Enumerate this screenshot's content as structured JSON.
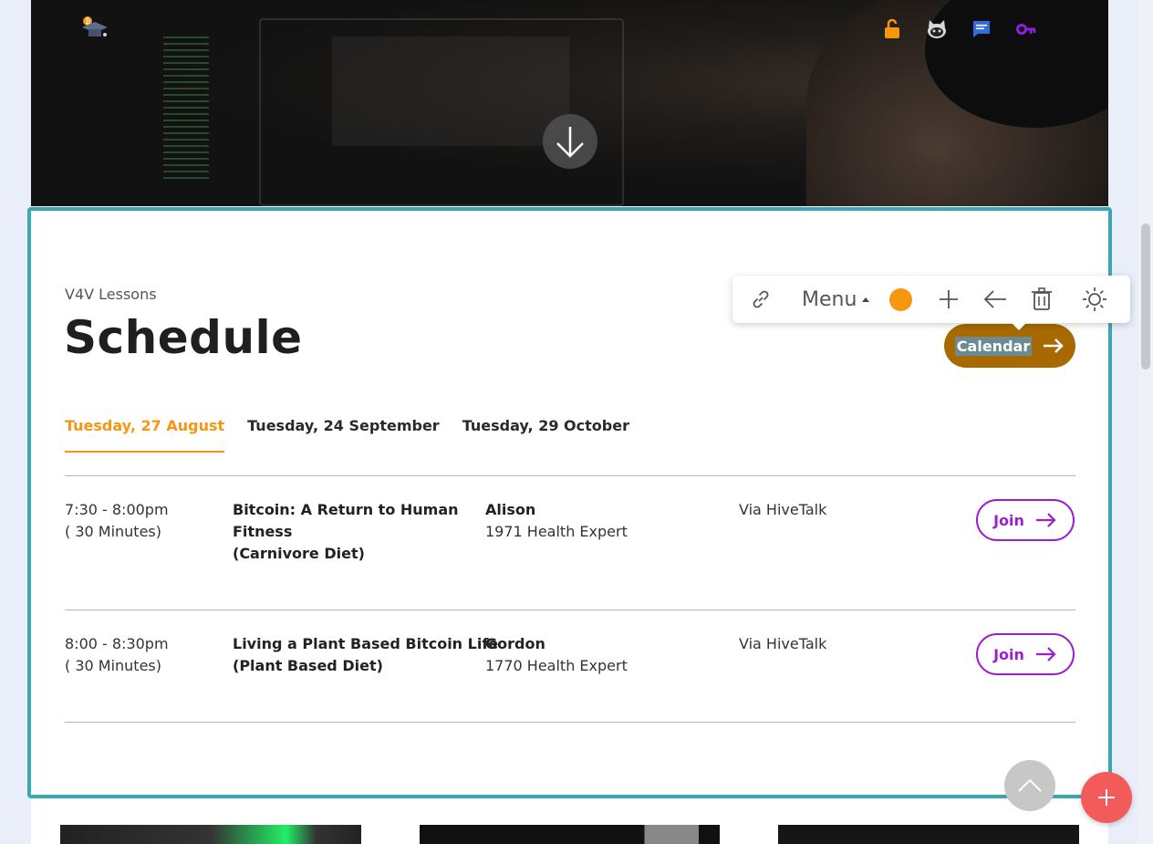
{
  "hero": {
    "icons": [
      "logo-icon",
      "unlock-icon",
      "github-icon",
      "chat-icon",
      "key-icon",
      "arrow-down-icon"
    ]
  },
  "schedule": {
    "eyebrow": "V4V Lessons",
    "title": "Schedule",
    "calendar_label": "Calendar",
    "tabs": [
      {
        "label": "Tuesday, 27 August",
        "active": true
      },
      {
        "label": "Tuesday, 24 September",
        "active": false
      },
      {
        "label": "Tuesday, 29 October",
        "active": false
      }
    ],
    "sessions": [
      {
        "time": "7:30 - 8:00pm",
        "duration": "( 30 Minutes)",
        "topic_line1": "Bitcoin: A Return to Human Fitness",
        "topic_line2": "(Carnivore Diet)",
        "speaker": "Alison",
        "role": "1971 Health Expert",
        "via": "Via HiveTalk",
        "join_label": "Join"
      },
      {
        "time": "8:00 - 8:30pm",
        "duration": "( 30 Minutes)",
        "topic_line1": "Living a Plant Based Bitcoin Life",
        "topic_line2": "(Plant Based Diet)",
        "speaker": "Gordon",
        "role": "1770 Health Expert",
        "via": "Via HiveTalk",
        "join_label": "Join"
      }
    ]
  },
  "toolbar": {
    "menu_label": "Menu",
    "color_swatch": "#f7960f",
    "icons": [
      "link-icon",
      "caret-up-icon",
      "plus-icon",
      "arrow-left-icon",
      "trash-icon",
      "sun-icon"
    ]
  },
  "colors": {
    "accent_orange": "#f7960f",
    "section_border": "#3aa8b4",
    "join_purple": "#9b1ecf",
    "calendar_button": "#a86a00",
    "add_button": "#f35b5b"
  }
}
